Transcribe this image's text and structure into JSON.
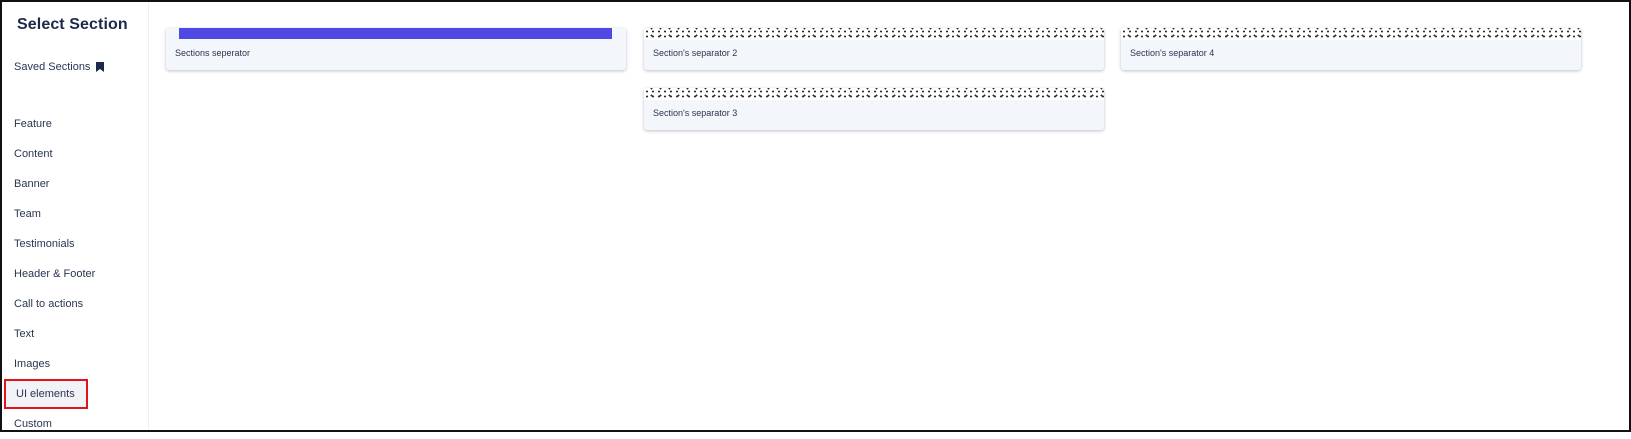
{
  "sidebar": {
    "title": "Select Section",
    "saved_sections_label": "Saved Sections",
    "saved_icon": "bookmark-icon",
    "categories": [
      {
        "label": "Feature"
      },
      {
        "label": "Content"
      },
      {
        "label": "Banner"
      },
      {
        "label": "Team"
      },
      {
        "label": "Testimonials"
      },
      {
        "label": "Header & Footer"
      },
      {
        "label": "Call to actions"
      },
      {
        "label": "Text"
      },
      {
        "label": "Images"
      },
      {
        "label": "UI elements"
      },
      {
        "label": "Custom"
      }
    ],
    "selected_category": "UI elements"
  },
  "sections": [
    {
      "label": "Sections seperator",
      "preview": "solid",
      "preview_color": "#5048e5"
    },
    {
      "label": "Section's separator 2",
      "preview": "dotted"
    },
    {
      "label": "Section's separator 4",
      "preview": "dotted"
    },
    {
      "label": "Section's separator 3",
      "preview": "dotted"
    }
  ],
  "colors": {
    "highlight_border": "#e0141b",
    "accent": "#5048e5",
    "text": "#1b2a4a"
  }
}
